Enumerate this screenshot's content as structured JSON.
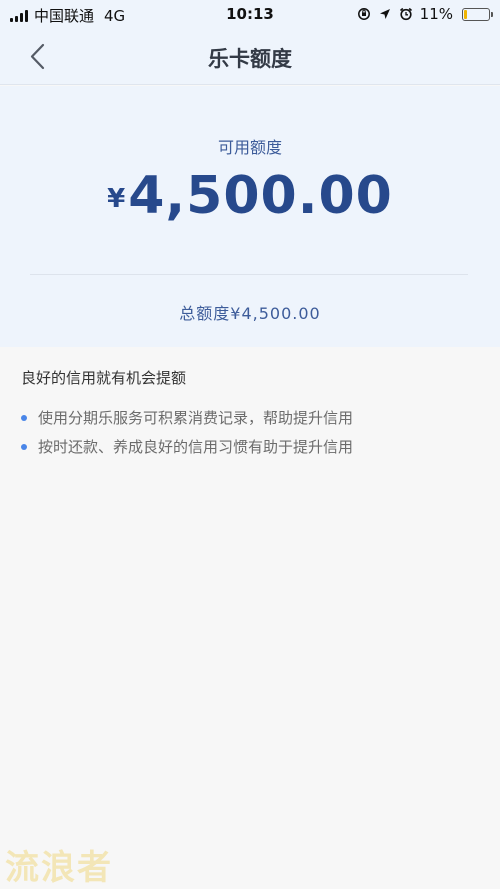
{
  "status_bar": {
    "carrier": "中国联通",
    "network": "4G",
    "time": "10:13",
    "battery_text": "11%",
    "battery_level": 0.11,
    "battery_color": "#f0b400"
  },
  "nav": {
    "back_icon": "chevron-left-icon",
    "title": "乐卡额度"
  },
  "limit": {
    "available_label": "可用额度",
    "currency_symbol": "¥",
    "available_amount": "4,500.00",
    "total_text": "总额度¥4,500.00"
  },
  "tips": {
    "title": "良好的信用就有机会提额",
    "items": [
      "使用分期乐服务可积累消费记录，帮助提升信用",
      "按时还款、养成良好的信用习惯有助于提升信用"
    ],
    "bullet_color": "#4a86e8"
  },
  "watermark": "流浪者",
  "colors": {
    "header_bg": "#eef4fc",
    "page_bg": "#f7f7f7",
    "amount_blue": "#27498c",
    "label_blue": "#3d5c9a"
  }
}
